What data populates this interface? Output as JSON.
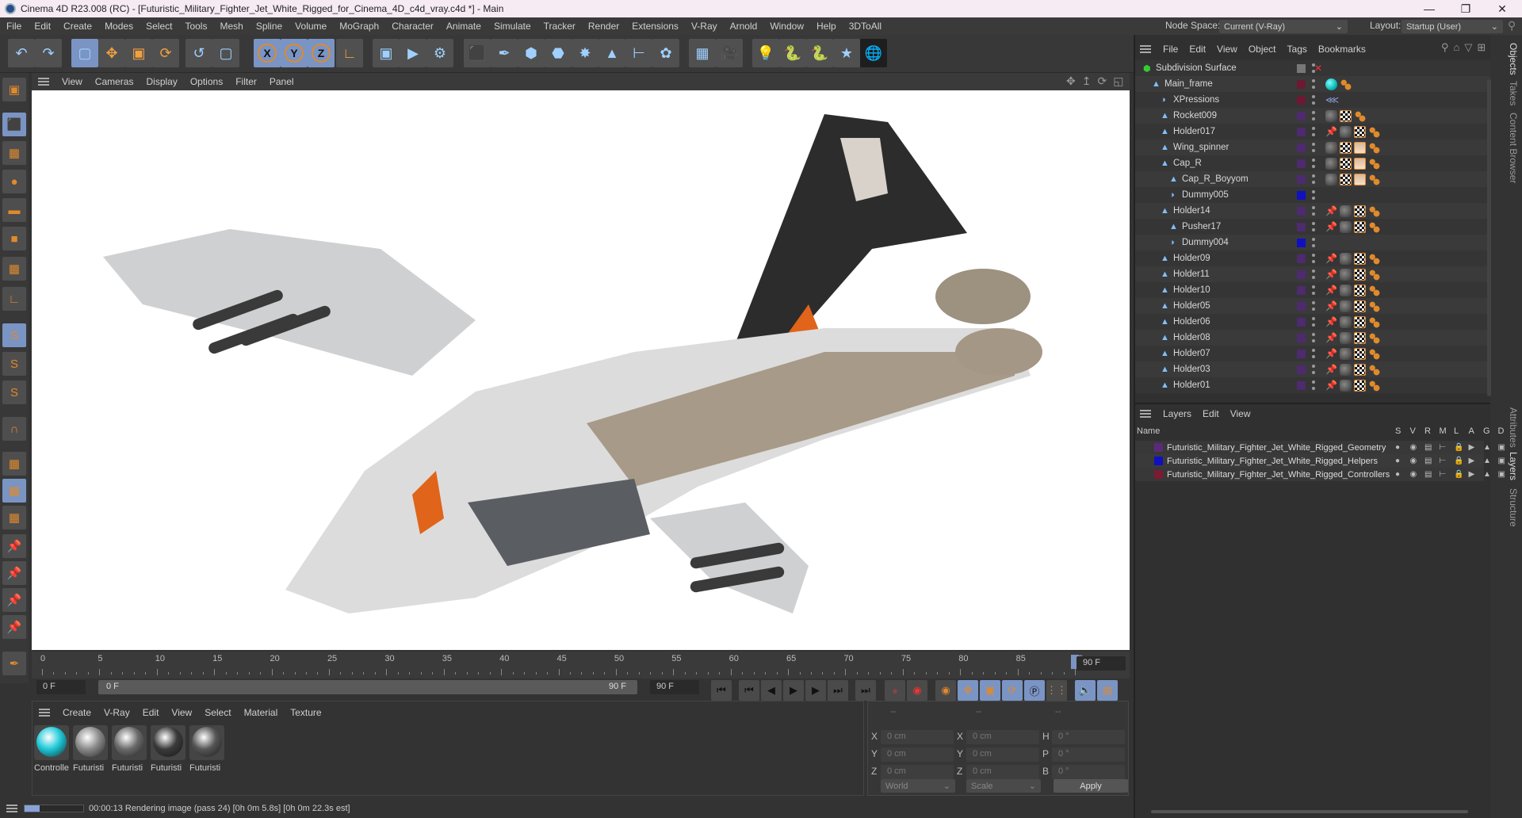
{
  "window": {
    "title": "Cinema 4D R23.008 (RC) - [Futuristic_Military_Fighter_Jet_White_Rigged_for_Cinema_4D_c4d_vray.c4d *] - Main",
    "controls": [
      "minimize",
      "maximize",
      "close"
    ]
  },
  "menu": [
    "File",
    "Edit",
    "Create",
    "Modes",
    "Select",
    "Tools",
    "Mesh",
    "Spline",
    "Volume",
    "MoGraph",
    "Character",
    "Animate",
    "Simulate",
    "Tracker",
    "Render",
    "Extensions",
    "V-Ray",
    "Arnold",
    "Window",
    "Help",
    "3DToAll"
  ],
  "nodespace": {
    "label": "Node Space:",
    "value": "Current (V-Ray)"
  },
  "layout": {
    "label": "Layout:",
    "value": "Startup (User)"
  },
  "toolbar": {
    "icons": [
      "undo-icon",
      "redo-icon",
      "live-selection-icon",
      "move-icon",
      "scale-icon",
      "rotate-icon",
      "psr-icon",
      "selection-icon",
      "x-axis-icon",
      "y-axis-icon",
      "z-axis-icon",
      "coordinate-system-icon",
      "render-view-icon",
      "render-picture-viewer-icon",
      "render-settings-icon",
      "cube-icon",
      "pen-icon",
      "subdivision-icon",
      "extrude-icon",
      "cloner-icon",
      "mograph-icon",
      "symmetry-icon",
      "deformer-icon",
      "floor-icon",
      "camera-icon",
      "light-icon",
      "python-icon",
      "python2-icon",
      "vray-icon",
      "sky-icon"
    ]
  },
  "viewport": {
    "menu": [
      "View",
      "Cameras",
      "Display",
      "Options",
      "Filter",
      "Panel"
    ],
    "nav_icons": [
      "pan-icon",
      "dolly-icon",
      "orbit-icon",
      "maximize-view-icon"
    ]
  },
  "timeline": {
    "ticks": [
      "0",
      "5",
      "10",
      "15",
      "20",
      "25",
      "30",
      "35",
      "40",
      "45",
      "50",
      "55",
      "60",
      "65",
      "70",
      "75",
      "80",
      "85",
      "90"
    ],
    "current_frame_display": "90 F",
    "start_field": "0 F",
    "range_start": "0 F",
    "range_end": "90 F",
    "end_field": "90 F",
    "playhead_frame": 90
  },
  "material_manager": {
    "menu": [
      "Create",
      "V-Ray",
      "Edit",
      "View",
      "Select",
      "Material",
      "Texture"
    ],
    "materials": [
      {
        "name": "Controlle",
        "color": "#1ec8d8"
      },
      {
        "name": "Futuristi",
        "color": "#8a8a8a"
      },
      {
        "name": "Futuristi",
        "color": "#6a6a6a"
      },
      {
        "name": "Futuristi",
        "color": "#3a3a3a"
      },
      {
        "name": "Futuristi",
        "color": "#555555"
      }
    ]
  },
  "coordinates": {
    "header": [
      "--",
      "--",
      "--"
    ],
    "rows": [
      {
        "a": "X",
        "av": "0 cm",
        "b": "X",
        "bv": "0 cm",
        "c": "H",
        "cv": "0 °"
      },
      {
        "a": "Y",
        "av": "0 cm",
        "b": "Y",
        "bv": "0 cm",
        "c": "P",
        "cv": "0 °"
      },
      {
        "a": "Z",
        "av": "0 cm",
        "b": "Z",
        "bv": "0 cm",
        "c": "B",
        "cv": "0 °"
      }
    ],
    "mode": "World",
    "type": "Scale",
    "apply": "Apply"
  },
  "status": {
    "text": "00:00:13 Rendering image (pass 24) [0h  0m  5.8s] [0h  0m 22.3s est]",
    "progress": 0.25
  },
  "object_manager": {
    "menu": [
      "File",
      "Edit",
      "View",
      "Object",
      "Tags",
      "Bookmarks"
    ],
    "objects": [
      {
        "name": "Subdivision Surface",
        "indent": 0,
        "color": "",
        "tags": []
      },
      {
        "name": "Main_frame",
        "indent": 1,
        "color": "#6b1a33",
        "tags": [
          "sph",
          "dot"
        ]
      },
      {
        "name": "XPressions",
        "indent": 2,
        "color": "#6b1a33",
        "tags": [
          "xp"
        ]
      },
      {
        "name": "Rocket009",
        "indent": 2,
        "color": "#4e2a6e",
        "tags": [
          "mat",
          "chk",
          "dot"
        ]
      },
      {
        "name": "Holder017",
        "indent": 2,
        "color": "#4e2a6e",
        "tags": [
          "pin",
          "mat",
          "chk",
          "dot"
        ]
      },
      {
        "name": "Wing_spinner",
        "indent": 2,
        "color": "#4e2a6e",
        "tags": [
          "mat",
          "chk",
          "grid",
          "dot"
        ]
      },
      {
        "name": "Cap_R",
        "indent": 2,
        "color": "#4e2a6e",
        "tags": [
          "mat",
          "chk",
          "grid",
          "dot"
        ]
      },
      {
        "name": "Cap_R_Boyyom",
        "indent": 3,
        "color": "#4e2a6e",
        "tags": [
          "mat",
          "chk",
          "grid",
          "dot"
        ]
      },
      {
        "name": "Dummy005",
        "indent": 3,
        "color": "#1010c0",
        "tags": []
      },
      {
        "name": "Holder14",
        "indent": 2,
        "color": "#4e2a6e",
        "tags": [
          "pin",
          "mat",
          "chk",
          "dot"
        ]
      },
      {
        "name": "Pusher17",
        "indent": 3,
        "color": "#4e2a6e",
        "tags": [
          "pin",
          "mat",
          "chk",
          "dot"
        ]
      },
      {
        "name": "Dummy004",
        "indent": 3,
        "color": "#1010c0",
        "tags": []
      },
      {
        "name": "Holder09",
        "indent": 2,
        "color": "#4e2a6e",
        "tags": [
          "pin",
          "mat",
          "chk",
          "dot"
        ]
      },
      {
        "name": "Holder11",
        "indent": 2,
        "color": "#4e2a6e",
        "tags": [
          "pin",
          "mat",
          "chk",
          "dot"
        ]
      },
      {
        "name": "Holder10",
        "indent": 2,
        "color": "#4e2a6e",
        "tags": [
          "pin",
          "mat",
          "chk",
          "dot"
        ]
      },
      {
        "name": "Holder05",
        "indent": 2,
        "color": "#4e2a6e",
        "tags": [
          "pin",
          "mat",
          "chk",
          "dot"
        ]
      },
      {
        "name": "Holder06",
        "indent": 2,
        "color": "#4e2a6e",
        "tags": [
          "pin",
          "mat",
          "chk",
          "dot"
        ]
      },
      {
        "name": "Holder08",
        "indent": 2,
        "color": "#4e2a6e",
        "tags": [
          "pin",
          "mat",
          "chk",
          "dot"
        ]
      },
      {
        "name": "Holder07",
        "indent": 2,
        "color": "#4e2a6e",
        "tags": [
          "pin",
          "mat",
          "chk",
          "dot"
        ]
      },
      {
        "name": "Holder03",
        "indent": 2,
        "color": "#4e2a6e",
        "tags": [
          "pin",
          "mat",
          "chk",
          "dot"
        ]
      },
      {
        "name": "Holder01",
        "indent": 2,
        "color": "#4e2a6e",
        "tags": [
          "pin",
          "mat",
          "chk",
          "dot"
        ]
      }
    ]
  },
  "layers": {
    "menu": [
      "Layers",
      "Edit",
      "View"
    ],
    "header": {
      "name": "Name",
      "cols": [
        "S",
        "V",
        "R",
        "M",
        "L",
        "A",
        "G",
        "D"
      ]
    },
    "items": [
      {
        "name": "Futuristic_Military_Fighter_Jet_White_Rigged_Geometry",
        "color": "#5a2a7a"
      },
      {
        "name": "Futuristic_Military_Fighter_Jet_White_Rigged_Helpers",
        "color": "#1010c0"
      },
      {
        "name": "Futuristic_Military_Fighter_Jet_White_Rigged_Controllers",
        "color": "#7a1a33"
      }
    ]
  },
  "side_tabs_top": [
    "Objects",
    "Takes",
    "Content Browser"
  ],
  "side_tabs_bottom": [
    "Attributes",
    "Layers",
    "Structure"
  ]
}
